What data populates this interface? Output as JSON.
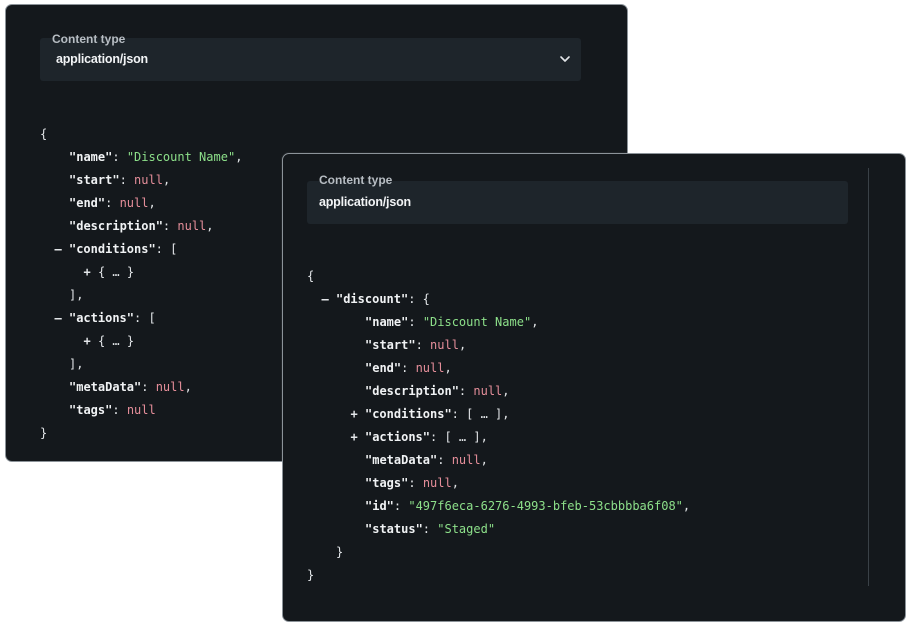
{
  "panel_a": {
    "content_type_label": "Content type",
    "content_type_value": "application/json",
    "lines": [
      {
        "indent": 0,
        "toggle": "",
        "key": "",
        "sep": "",
        "val": "",
        "val_class": "punc",
        "punc": "{"
      },
      {
        "indent": 2,
        "toggle": "",
        "key": "\"name\"",
        "sep": ": ",
        "val": "\"Discount Name\"",
        "val_class": "str",
        "punc": ","
      },
      {
        "indent": 2,
        "toggle": "",
        "key": "\"start\"",
        "sep": ": ",
        "val": "null",
        "val_class": "nul",
        "punc": ","
      },
      {
        "indent": 2,
        "toggle": "",
        "key": "\"end\"",
        "sep": ": ",
        "val": "null",
        "val_class": "nul",
        "punc": ","
      },
      {
        "indent": 2,
        "toggle": "",
        "key": "\"description\"",
        "sep": ": ",
        "val": "null",
        "val_class": "nul",
        "punc": ","
      },
      {
        "indent": 1,
        "toggle": "–",
        "key": "\"conditions\"",
        "sep": ": ",
        "val": "",
        "val_class": "punc",
        "punc": "["
      },
      {
        "indent": 3,
        "toggle": "+",
        "key": "",
        "sep": "",
        "val": "",
        "val_class": "punc",
        "punc": "{ … }"
      },
      {
        "indent": 2,
        "toggle": "",
        "key": "",
        "sep": "",
        "val": "",
        "val_class": "punc",
        "punc": "],"
      },
      {
        "indent": 1,
        "toggle": "–",
        "key": "\"actions\"",
        "sep": ": ",
        "val": "",
        "val_class": "punc",
        "punc": "["
      },
      {
        "indent": 3,
        "toggle": "+",
        "key": "",
        "sep": "",
        "val": "",
        "val_class": "punc",
        "punc": "{ … }"
      },
      {
        "indent": 2,
        "toggle": "",
        "key": "",
        "sep": "",
        "val": "",
        "val_class": "punc",
        "punc": "],"
      },
      {
        "indent": 2,
        "toggle": "",
        "key": "\"metaData\"",
        "sep": ": ",
        "val": "null",
        "val_class": "nul",
        "punc": ","
      },
      {
        "indent": 2,
        "toggle": "",
        "key": "\"tags\"",
        "sep": ": ",
        "val": "null",
        "val_class": "nul",
        "punc": ""
      },
      {
        "indent": 0,
        "toggle": "",
        "key": "",
        "sep": "",
        "val": "",
        "val_class": "punc",
        "punc": "}"
      }
    ]
  },
  "panel_b": {
    "content_type_label": "Content type",
    "content_type_value": "application/json",
    "lines": [
      {
        "indent": 0,
        "toggle": "",
        "key": "",
        "sep": "",
        "val": "",
        "val_class": "punc",
        "punc": "{"
      },
      {
        "indent": 1,
        "toggle": "–",
        "key": "\"discount\"",
        "sep": ": ",
        "val": "",
        "val_class": "punc",
        "punc": "{"
      },
      {
        "indent": 4,
        "toggle": "",
        "key": "\"name\"",
        "sep": ": ",
        "val": "\"Discount Name\"",
        "val_class": "str",
        "punc": ","
      },
      {
        "indent": 4,
        "toggle": "",
        "key": "\"start\"",
        "sep": ": ",
        "val": "null",
        "val_class": "nul",
        "punc": ","
      },
      {
        "indent": 4,
        "toggle": "",
        "key": "\"end\"",
        "sep": ": ",
        "val": "null",
        "val_class": "nul",
        "punc": ","
      },
      {
        "indent": 4,
        "toggle": "",
        "key": "\"description\"",
        "sep": ": ",
        "val": "null",
        "val_class": "nul",
        "punc": ","
      },
      {
        "indent": 3,
        "toggle": "+",
        "key": "\"conditions\"",
        "sep": ": ",
        "val": "",
        "val_class": "punc",
        "punc": "[ … ],"
      },
      {
        "indent": 3,
        "toggle": "+",
        "key": "\"actions\"",
        "sep": ": ",
        "val": "",
        "val_class": "punc",
        "punc": "[ … ],"
      },
      {
        "indent": 4,
        "toggle": "",
        "key": "\"metaData\"",
        "sep": ": ",
        "val": "null",
        "val_class": "nul",
        "punc": ","
      },
      {
        "indent": 4,
        "toggle": "",
        "key": "\"tags\"",
        "sep": ": ",
        "val": "null",
        "val_class": "nul",
        "punc": ","
      },
      {
        "indent": 4,
        "toggle": "",
        "key": "\"id\"",
        "sep": ": ",
        "val": "\"497f6eca-6276-4993-bfeb-53cbbbba6f08\"",
        "val_class": "str",
        "punc": ","
      },
      {
        "indent": 4,
        "toggle": "",
        "key": "\"status\"",
        "sep": ": ",
        "val": "\"Staged\"",
        "val_class": "str",
        "punc": ""
      },
      {
        "indent": 2,
        "toggle": "",
        "key": "",
        "sep": "",
        "val": "",
        "val_class": "punc",
        "punc": "}"
      },
      {
        "indent": 0,
        "toggle": "",
        "key": "",
        "sep": "",
        "val": "",
        "val_class": "punc",
        "punc": "}"
      }
    ]
  },
  "icons": {
    "select_chevron": "chevron-down-icon",
    "expand": "plus-toggle",
    "collapse": "minus-toggle"
  },
  "colors": {
    "panel_bg": "#14181c",
    "select_bg": "#1e252b",
    "string": "#8de08a",
    "null": "#e58e9a"
  }
}
